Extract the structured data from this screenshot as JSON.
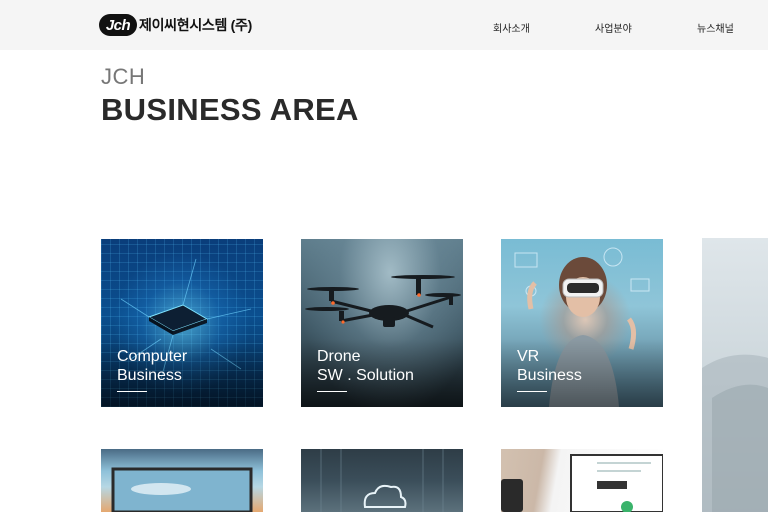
{
  "header": {
    "logo_mark": "Jch",
    "logo_small": "(주)",
    "logo_text": "제이씨현시스템 (주)",
    "nav": [
      {
        "label": "회사소개"
      },
      {
        "label": "사업분야"
      },
      {
        "label": "뉴스채널"
      }
    ]
  },
  "hero": {
    "subtitle": "JCH",
    "title": "BUSINESS AREA"
  },
  "cards": [
    {
      "line1": "Computer",
      "line2": "Business"
    },
    {
      "line1": "Drone",
      "line2": "SW . Solution"
    },
    {
      "line1": "VR",
      "line2": "Business"
    }
  ]
}
